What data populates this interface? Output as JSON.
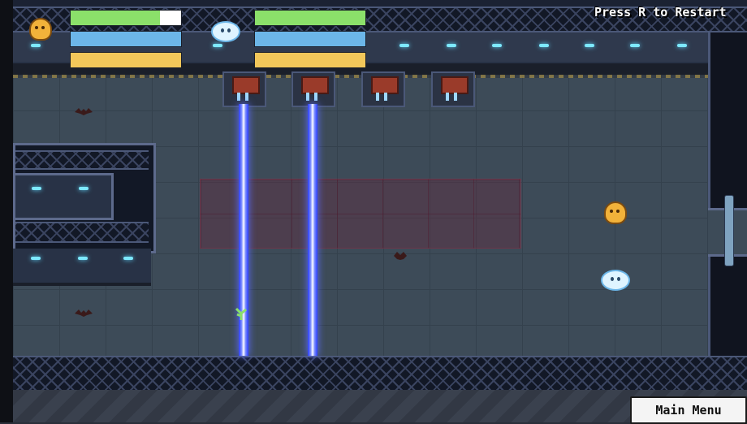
{
  "hud": {
    "restart_hint": "Press R to Restart",
    "players": [
      {
        "avatar_icon": "yellow-robot-icon",
        "health_fraction": 0.81,
        "stamina_fraction": 1.0,
        "energy_fraction": 1.0
      },
      {
        "avatar_icon": "blue-robot-icon",
        "health_fraction": 1.0,
        "stamina_fraction": 1.0,
        "energy_fraction": 1.0
      }
    ],
    "bar_colors": {
      "health": "#8be06a",
      "stamina": "#6cb6e8",
      "energy": "#f2c75a",
      "empty": "#ffffff"
    }
  },
  "menu": {
    "main_menu_label": "Main Menu"
  },
  "scene": {
    "laser_color": "#5a6cff",
    "turret_count": 4,
    "active_lasers": 2,
    "enemies": [
      "bat-icon",
      "bat-icon",
      "bat-icon"
    ],
    "characters": [
      "yellow-robot",
      "blue-robot"
    ],
    "pickups": [
      "plant-icon"
    ]
  }
}
